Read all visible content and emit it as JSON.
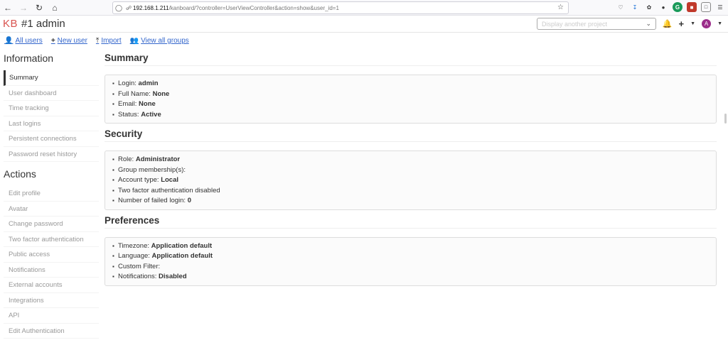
{
  "browser": {
    "url_host": "192.168.1.211",
    "url_path": "/kanboard/?controller=UserViewController&action=show&user_id=1"
  },
  "header": {
    "logo": "KB",
    "title": "#1 admin",
    "project_select_placeholder": "Display another project"
  },
  "actions": {
    "all_users": "All users",
    "new_user": "New user",
    "import": "Import",
    "view_all_groups": "View all groups"
  },
  "sidebar": {
    "information_heading": "Information",
    "information_items": [
      "Summary",
      "User dashboard",
      "Time tracking",
      "Last logins",
      "Persistent connections",
      "Password reset history"
    ],
    "actions_heading": "Actions",
    "actions_items": [
      "Edit profile",
      "Avatar",
      "Change password",
      "Two factor authentication",
      "Public access",
      "Notifications",
      "External accounts",
      "Integrations",
      "API",
      "Edit Authentication"
    ]
  },
  "summary": {
    "title": "Summary",
    "login_label": "Login: ",
    "login_value": "admin",
    "fullname_label": "Full Name: ",
    "fullname_value": "None",
    "email_label": "Email: ",
    "email_value": "None",
    "status_label": "Status: ",
    "status_value": "Active"
  },
  "security": {
    "title": "Security",
    "role_label": "Role: ",
    "role_value": "Administrator",
    "group_label": "Group membership(s):",
    "account_label": "Account type: ",
    "account_value": "Local",
    "twofactor": "Two factor authentication disabled",
    "failed_label": "Number of failed login: ",
    "failed_value": "0"
  },
  "preferences": {
    "title": "Preferences",
    "timezone_label": "Timezone: ",
    "timezone_value": "Application default",
    "language_label": "Language: ",
    "language_value": "Application default",
    "filter_label": "Custom Filter:",
    "notif_label": "Notifications: ",
    "notif_value": "Disabled"
  },
  "avatar_letter": "A"
}
